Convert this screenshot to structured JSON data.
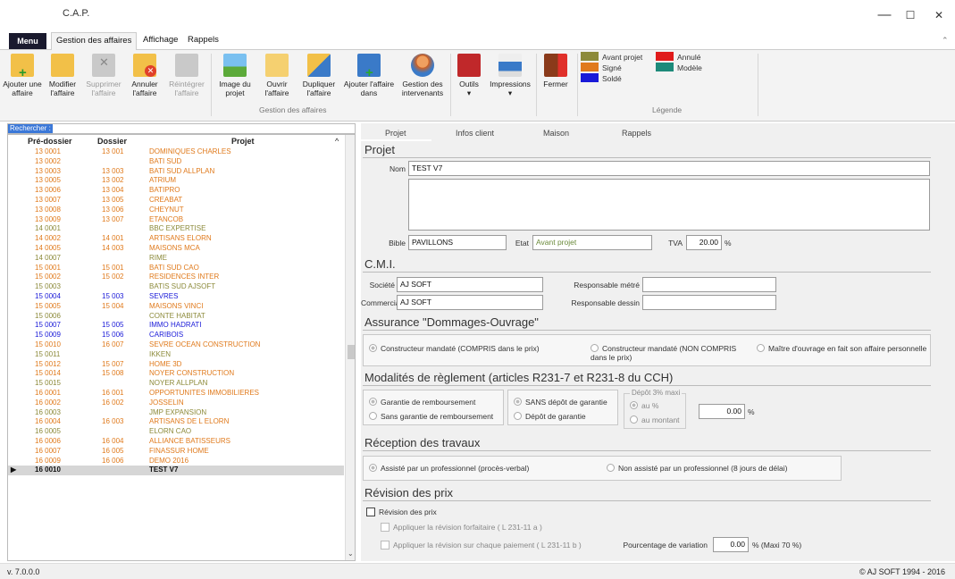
{
  "window": {
    "title": "C.A.P.",
    "minimize": "—",
    "maximize": "☐",
    "close": "✕"
  },
  "menubar": {
    "menu_label": "Menu",
    "tabs": [
      "Gestion des affaires",
      "Affichage",
      "Rappels"
    ]
  },
  "ribbon": {
    "buttons": {
      "ajouter": "Ajouter une affaire",
      "modifier": "Modifier l'affaire",
      "supprimer": "Supprimer l'affaire",
      "annuler": "Annuler l'affaire",
      "reintegrer": "Réintégrer l'affaire",
      "image": "Image du projet",
      "ouvrir": "Ouvrir l'affaire",
      "dupliquer": "Dupliquer l'affaire",
      "ajouter_dans": "Ajouter l'affaire dans",
      "intervenants": "Gestion des intervenants",
      "outils": "Outils",
      "impressions": "Impressions",
      "fermer": "Fermer"
    },
    "group_label": "Gestion des affaires",
    "legend_label": "Légende",
    "legend": [
      {
        "label": "Avant projet",
        "color": "#8c8a3a"
      },
      {
        "label": "Signé",
        "color": "#e07a1c"
      },
      {
        "label": "Soldé",
        "color": "#1a1ad8"
      },
      {
        "label": "Annulé",
        "color": "#e01b1b"
      },
      {
        "label": "Modèle",
        "color": "#1d8a7a"
      }
    ]
  },
  "search": {
    "label": "Rechercher :"
  },
  "grid": {
    "headers": [
      "Pré-dossier",
      "Dossier",
      "Projet"
    ],
    "rows": [
      {
        "pre": "13 0001",
        "dos": "13 001",
        "proj": "DOMINIQUES CHARLES",
        "c": "#e07a1c"
      },
      {
        "pre": "13 0002",
        "dos": "",
        "proj": "BATI SUD",
        "c": "#e07a1c"
      },
      {
        "pre": "13 0003",
        "dos": "13 003",
        "proj": "BATI SUD ALLPLAN",
        "c": "#e07a1c"
      },
      {
        "pre": "13 0005",
        "dos": "13 002",
        "proj": "ATRIUM",
        "c": "#e07a1c"
      },
      {
        "pre": "13 0006",
        "dos": "13 004",
        "proj": "BATIPRO",
        "c": "#e07a1c"
      },
      {
        "pre": "13 0007",
        "dos": "13 005",
        "proj": "CREABAT",
        "c": "#e07a1c"
      },
      {
        "pre": "13 0008",
        "dos": "13 006",
        "proj": "CHEYNUT",
        "c": "#e07a1c"
      },
      {
        "pre": "13 0009",
        "dos": "13 007",
        "proj": "ETANCOB",
        "c": "#e07a1c"
      },
      {
        "pre": "14 0001",
        "dos": "",
        "proj": "BBC EXPERTISE",
        "c": "#8c8a3a"
      },
      {
        "pre": "14 0002",
        "dos": "14 001",
        "proj": "ARTISANS ELORN",
        "c": "#e07a1c"
      },
      {
        "pre": "14 0005",
        "dos": "14 003",
        "proj": "MAISONS MCA",
        "c": "#e07a1c"
      },
      {
        "pre": "14 0007",
        "dos": "",
        "proj": "RIME",
        "c": "#8c8a3a"
      },
      {
        "pre": "15 0001",
        "dos": "15 001",
        "proj": "BATI SUD CAO",
        "c": "#e07a1c"
      },
      {
        "pre": "15 0002",
        "dos": "15 002",
        "proj": "RESIDENCES INTER",
        "c": "#e07a1c"
      },
      {
        "pre": "15 0003",
        "dos": "",
        "proj": "BATIS SUD AJSOFT",
        "c": "#8c8a3a"
      },
      {
        "pre": "15 0004",
        "dos": "15 003",
        "proj": "SEVRES",
        "c": "#1a1ad8"
      },
      {
        "pre": "15 0005",
        "dos": "15 004",
        "proj": "MAISONS VINCI",
        "c": "#e07a1c"
      },
      {
        "pre": "15 0006",
        "dos": "",
        "proj": "CONTE HABITAT",
        "c": "#8c8a3a"
      },
      {
        "pre": "15 0007",
        "dos": "15 005",
        "proj": "IMMO HADRATI",
        "c": "#1a1ad8"
      },
      {
        "pre": "15 0009",
        "dos": "15 006",
        "proj": "CARIBOIS",
        "c": "#1a1ad8"
      },
      {
        "pre": "15 0010",
        "dos": "16 007",
        "proj": "SEVRE OCEAN CONSTRUCTION",
        "c": "#e07a1c"
      },
      {
        "pre": "15 0011",
        "dos": "",
        "proj": "IKKEN",
        "c": "#8c8a3a"
      },
      {
        "pre": "15 0012",
        "dos": "15 007",
        "proj": "HOME 3D",
        "c": "#e07a1c"
      },
      {
        "pre": "15 0014",
        "dos": "15 008",
        "proj": "NOYER CONSTRUCTION",
        "c": "#e07a1c"
      },
      {
        "pre": "15 0015",
        "dos": "",
        "proj": "NOYER ALLPLAN",
        "c": "#8c8a3a"
      },
      {
        "pre": "16 0001",
        "dos": "16 001",
        "proj": "OPPORTUNITES IMMOBILIERES",
        "c": "#e07a1c"
      },
      {
        "pre": "16 0002",
        "dos": "16 002",
        "proj": "JOSSELIN",
        "c": "#e07a1c"
      },
      {
        "pre": "16 0003",
        "dos": "",
        "proj": "JMP EXPANSION",
        "c": "#8c8a3a"
      },
      {
        "pre": "16 0004",
        "dos": "16 003",
        "proj": "ARTISANS DE L ELORN",
        "c": "#e07a1c"
      },
      {
        "pre": "16 0005",
        "dos": "",
        "proj": "ELORN CAO",
        "c": "#8c8a3a"
      },
      {
        "pre": "16 0006",
        "dos": "16 004",
        "proj": "ALLIANCE BATISSEURS",
        "c": "#e07a1c"
      },
      {
        "pre": "16 0007",
        "dos": "16 005",
        "proj": "FINASSUR HOME",
        "c": "#e07a1c"
      },
      {
        "pre": "16 0009",
        "dos": "16 006",
        "proj": "DEMO 2016",
        "c": "#e07a1c"
      },
      {
        "pre": "16 0010",
        "dos": "",
        "proj": "TEST V7",
        "c": "#111111",
        "selected": true
      }
    ]
  },
  "tabs": [
    "Projet",
    "Infos client",
    "Maison",
    "Rappels"
  ],
  "projet": {
    "section": "Projet",
    "nom_label": "Nom",
    "nom_value": "TEST V7",
    "bible_label": "Bible",
    "bible_value": "PAVILLONS",
    "etat_label": "Etat",
    "etat_value": "Avant projet",
    "tva_label": "TVA",
    "tva_value": "20.00",
    "tva_unit": "%"
  },
  "cmi": {
    "section": "C.M.I.",
    "societe_label": "Société",
    "societe_value": "AJ SOFT",
    "commercial_label": "Commercial",
    "commercial_value": "AJ SOFT",
    "resp_metre_label": "Responsable métré",
    "resp_dessin_label": "Responsable dessin"
  },
  "assurance": {
    "section": "Assurance \"Dommages-Ouvrage\"",
    "opt1": "Constructeur mandaté (COMPRIS dans le prix)",
    "opt2": "Constructeur mandaté (NON COMPRIS dans le prix)",
    "opt3": "Maître d'ouvrage en fait son affaire personnelle"
  },
  "reglement": {
    "section": "Modalités de règlement  (articles R231-7 et R231-8 du CCH)",
    "garantie": "Garantie de remboursement",
    "sans_garantie": "Sans garantie de remboursement",
    "sans_depot": "SANS dépôt de garantie",
    "depot": "Dépôt de garantie",
    "depot_group": "Dépôt 3% maxi",
    "au_pct": "au %",
    "au_montant": "au montant",
    "depot_value": "0.00",
    "depot_unit": "%"
  },
  "reception": {
    "section": "Réception des travaux",
    "opt1": "Assisté par un professionnel (procès-verbal)",
    "opt2": "Non assisté par un professionnel (8 jours de délai)"
  },
  "revision": {
    "section": "Révision des prix",
    "check": "Révision des prix",
    "forfaitaire": "Appliquer la révision forfaitaire ( L 231-11 a )",
    "chaque": "Appliquer la révision sur chaque paiement ( L 231-11 b )",
    "pct_label": "Pourcentage de variation",
    "pct_value": "0.00",
    "pct_unit": "% (Maxi 70 %)"
  },
  "status": {
    "version": "v. 7.0.0.0",
    "copyright": "© AJ SOFT 1994 - 2016"
  }
}
